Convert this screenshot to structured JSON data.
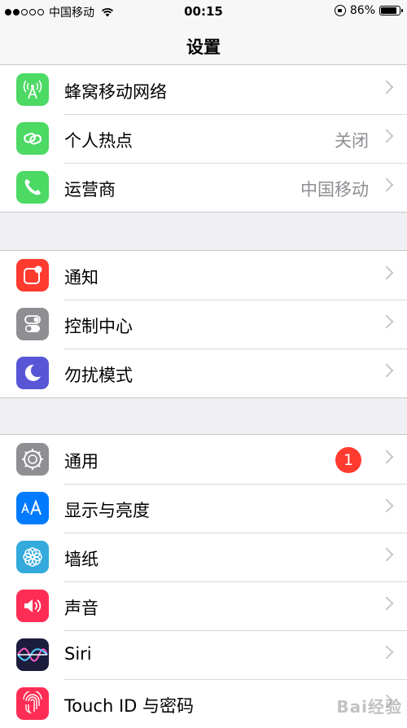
{
  "status_bar": {
    "carrier": "中国移动",
    "time": "00:15",
    "battery_percent": "86%",
    "battery_level": 0.86
  },
  "nav": {
    "title": "设置"
  },
  "groups": [
    [
      {
        "label": "蜂窝移动网络",
        "value": "",
        "icon": "cellular-antenna-icon",
        "color": "#4cd964"
      },
      {
        "label": "个人热点",
        "value": "关闭",
        "icon": "hotspot-chain-icon",
        "color": "#4cd964"
      },
      {
        "label": "运营商",
        "value": "中国移动",
        "icon": "phone-icon",
        "color": "#4cd964"
      }
    ],
    [
      {
        "label": "通知",
        "value": "",
        "icon": "notification-icon",
        "color": "#ff3b30"
      },
      {
        "label": "控制中心",
        "value": "",
        "icon": "control-center-toggles-icon",
        "color": "#8e8e93"
      },
      {
        "label": "勿扰模式",
        "value": "",
        "icon": "moon-icon",
        "color": "#5856d6"
      }
    ],
    [
      {
        "label": "通用",
        "value": "",
        "badge": "1",
        "icon": "gear-icon",
        "color": "#8e8e93"
      },
      {
        "label": "显示与亮度",
        "value": "",
        "icon": "text-size-icon",
        "color": "#007aff"
      },
      {
        "label": "墙纸",
        "value": "",
        "icon": "flower-icon",
        "color": "#34aadc"
      },
      {
        "label": "声音",
        "value": "",
        "icon": "speaker-icon",
        "color": "#ff2d55"
      },
      {
        "label": "Siri",
        "value": "",
        "icon": "siri-icon",
        "color": "#1c1c3c"
      },
      {
        "label": "Touch ID 与密码",
        "value": "",
        "icon": "fingerprint-icon",
        "color": "#ff2d55"
      }
    ]
  ],
  "watermark": "Bai经验"
}
